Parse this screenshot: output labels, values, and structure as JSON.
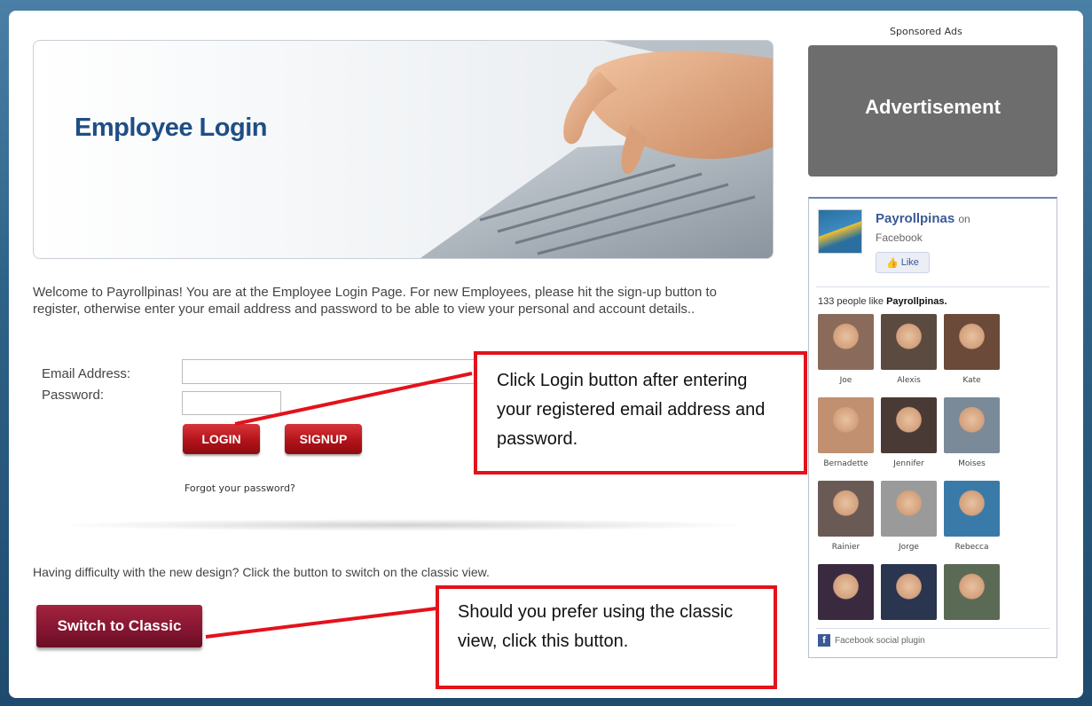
{
  "banner": {
    "title": "Employee Login"
  },
  "welcome_text": "Welcome to Payrollpinas! You are at the Employee Login Page. For new Employees, please hit the sign-up button to register, otherwise enter your email address and password to be able to view your personal and account details..",
  "form": {
    "email_label": "Email Address:",
    "password_label": "Password:",
    "email_value": "",
    "password_value": "",
    "login_label": "LOGIN",
    "signup_label": "SIGNUP",
    "forgot_label": "Forgot your password?"
  },
  "classic": {
    "prompt": "Having difficulty with the new design? Click the button to switch on the classic view.",
    "button_label": "Switch to Classic"
  },
  "callouts": {
    "login": "Click Login button after entering your registered email address and password.",
    "classic": "Should you prefer using the classic view, click this button."
  },
  "sidebar": {
    "sponsored_label": "Sponsored Ads",
    "ad_label": "Advertisement",
    "facebook": {
      "page_name": "Payrollpinas",
      "on_text": "on",
      "platform": "Facebook",
      "like_label": "Like",
      "count_prefix": "133 people like",
      "count_page": "Payrollpinas.",
      "people": [
        {
          "name": "Joe",
          "color": "#8a6a5a"
        },
        {
          "name": "Alexis",
          "color": "#5a4a40"
        },
        {
          "name": "Kate",
          "color": "#6b4a3a"
        },
        {
          "name": "Bernadette",
          "color": "#c09070"
        },
        {
          "name": "Jennifer",
          "color": "#4a3a35"
        },
        {
          "name": "Moises",
          "color": "#7a8a98"
        },
        {
          "name": "Rainier",
          "color": "#6a5a55"
        },
        {
          "name": "Jorge",
          "color": "#9a9a9a"
        },
        {
          "name": "Rebecca",
          "color": "#3a7aa8"
        },
        {
          "name": "",
          "color": "#3a2a40"
        },
        {
          "name": "",
          "color": "#2a3550"
        },
        {
          "name": "",
          "color": "#5a6a55"
        }
      ],
      "footer_label": "Facebook social plugin"
    }
  }
}
